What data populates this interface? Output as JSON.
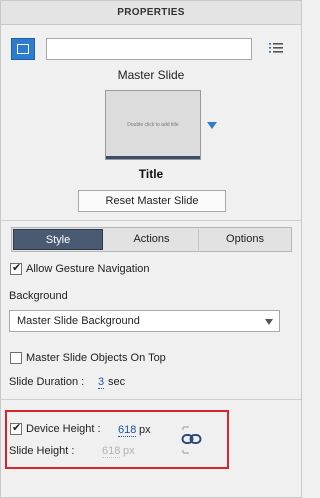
{
  "panel": {
    "title": "PROPERTIES"
  },
  "slide_name_field": {
    "value": "",
    "placeholder": ""
  },
  "master": {
    "section_label": "Master Slide",
    "thumbnail_text": "Double click to add title",
    "thumbnail_title": "Title",
    "reset_label": "Reset Master Slide"
  },
  "tabs": [
    {
      "label": "Style",
      "active": true
    },
    {
      "label": "Actions",
      "active": false
    },
    {
      "label": "Options",
      "active": false
    }
  ],
  "style": {
    "allow_gesture_label": "Allow Gesture Navigation",
    "allow_gesture_checked": true,
    "background_label": "Background",
    "background_value": "Master Slide Background",
    "master_objects_label": "Master Slide Objects On Top",
    "master_objects_checked": false,
    "duration_label": "Slide Duration :",
    "duration_value": "3",
    "duration_unit": "sec",
    "device_height_label": "Device Height :",
    "device_height_checked": true,
    "device_height_value": "618",
    "device_height_unit": "px",
    "slide_height_label": "Slide Height :",
    "slide_height_value": "618",
    "slide_height_unit": "px"
  },
  "colors": {
    "accent": "#2d7ccf",
    "active_tab": "#4a5a73",
    "highlight": "#d9262d",
    "link": "#1a56a8"
  },
  "icons": {
    "slide_button": "slide-icon",
    "menu": "list-menu-icon",
    "thumbnail_dropdown": "triangle-down-icon",
    "link": "chain-link-icon"
  }
}
